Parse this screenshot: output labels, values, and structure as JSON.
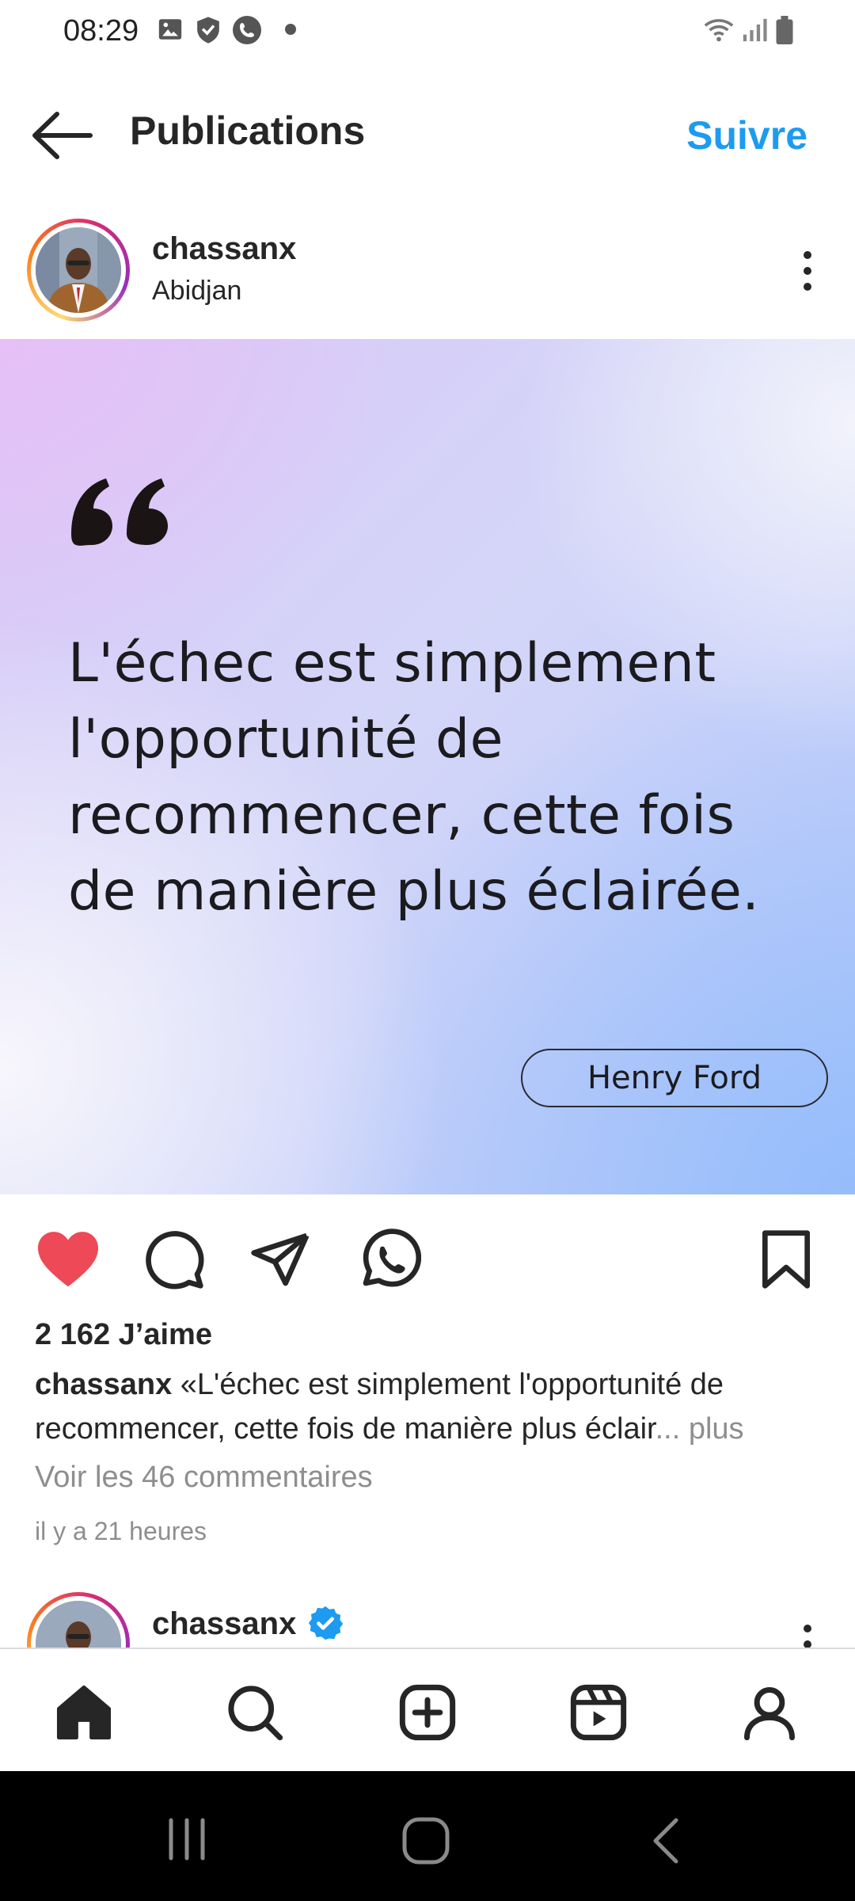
{
  "status_bar": {
    "time": "08:29",
    "left_icons": [
      "gallery-icon",
      "shield-icon",
      "phone-icon",
      "dot-icon"
    ],
    "right_icons": [
      "wifi-icon",
      "signal-icon",
      "battery-icon"
    ]
  },
  "header": {
    "back_icon": "arrow-left-icon",
    "title": "Publications",
    "follow_label": "Suivre",
    "accent_color": "#1d9bf0"
  },
  "post": {
    "username": "chassanx",
    "location": "Abidjan",
    "more_icon": "more-vertical-icon",
    "image": {
      "quote_icon": "quote-icon",
      "quote_text": "L'échec est simplement l'opportunité de recommencer, cette fois de manière plus éclairée.",
      "author": "Henry Ford"
    },
    "actions": {
      "like_icon": "heart-filled-icon",
      "like_color": "#ed4956",
      "comment_icon": "comment-icon",
      "share_icon": "send-icon",
      "whatsapp_icon": "whatsapp-icon",
      "save_icon": "bookmark-icon"
    },
    "likes": "2 162 J’aime",
    "caption_user": "chassanx",
    "caption_text": " «L'échec est simplement l'opportunité de recommencer, cette fois de manière plus éclair",
    "caption_more": "... plus",
    "comments_link": "Voir les 46 commentaires",
    "timestamp": "il y a 21 heures"
  },
  "next_post": {
    "username": "chassanx",
    "verified_icon": "verified-badge-icon"
  },
  "bottom_nav": {
    "items": [
      "home-icon",
      "search-icon",
      "create-icon",
      "reels-icon",
      "profile-icon"
    ]
  },
  "system_nav": {
    "items": [
      "recents-icon",
      "home-button-icon",
      "back-icon"
    ]
  }
}
